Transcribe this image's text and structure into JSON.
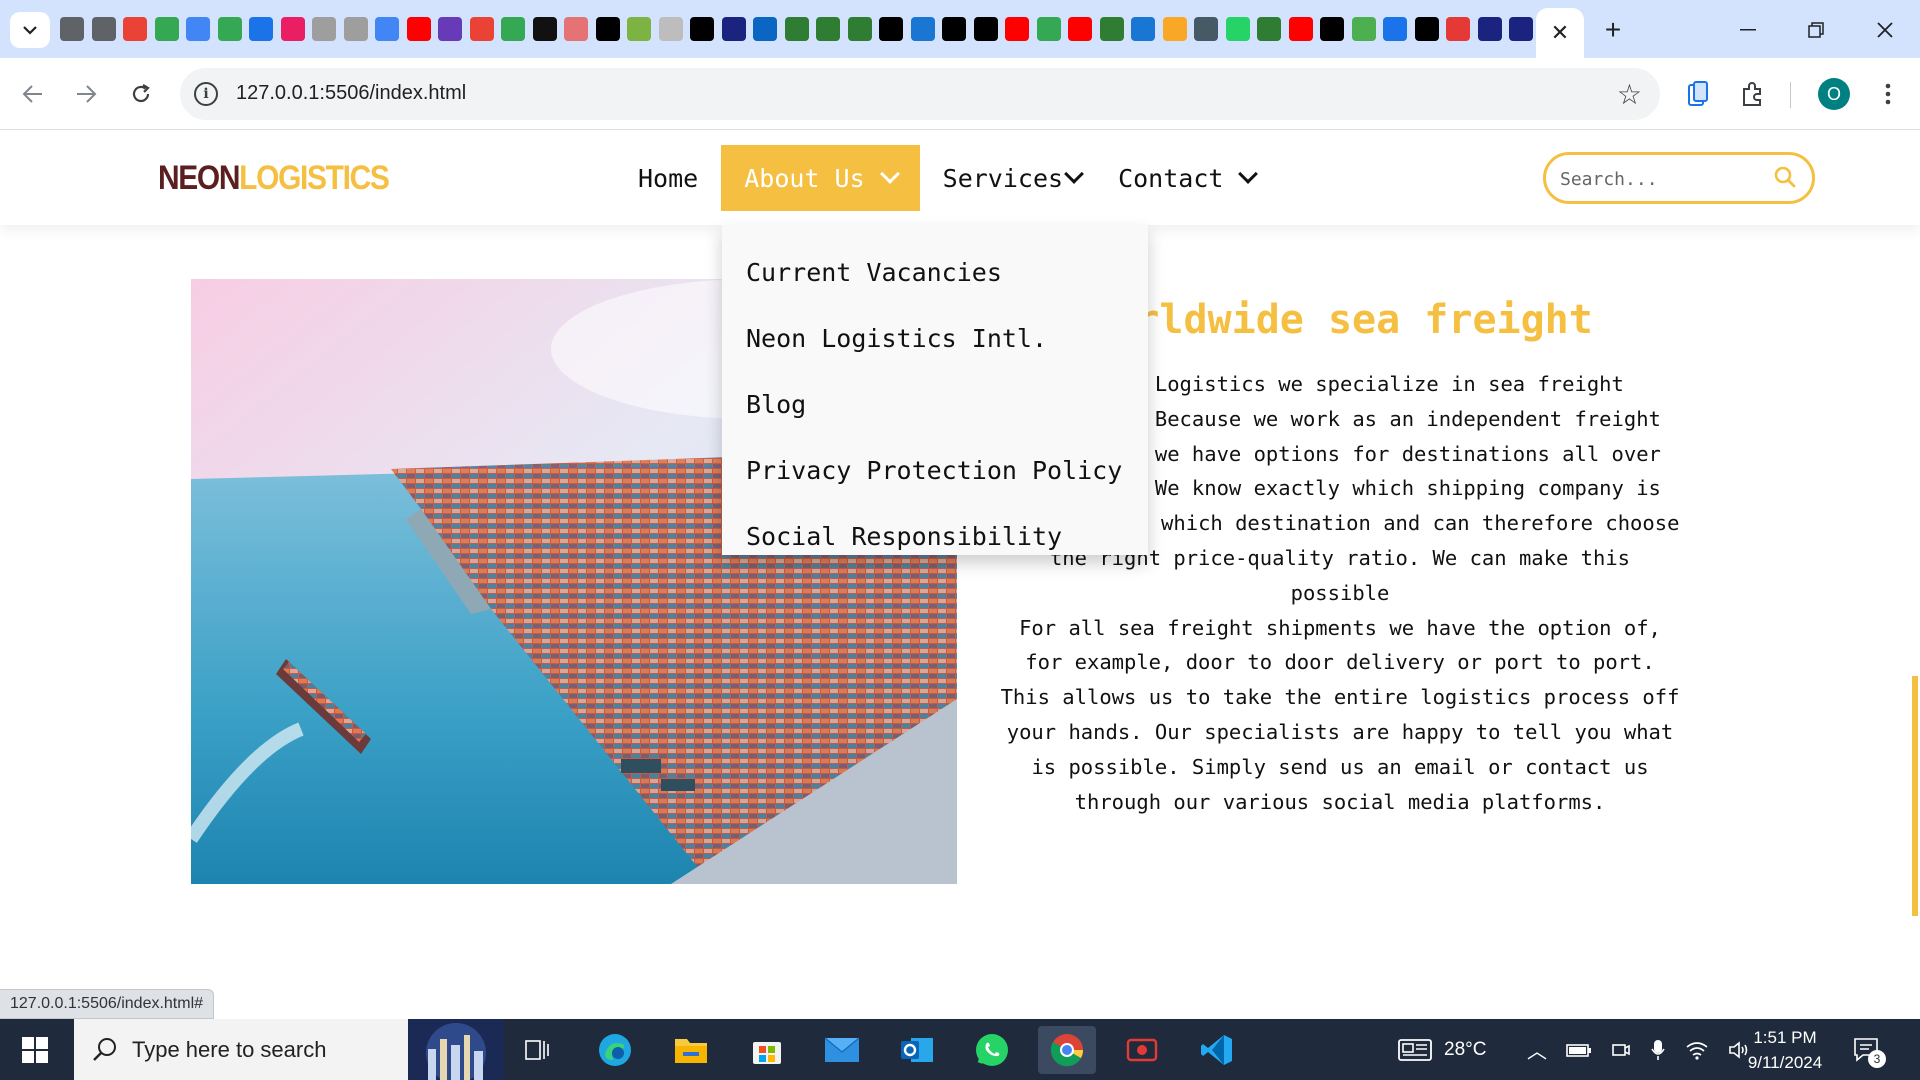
{
  "browser": {
    "active_tab_close": "✕",
    "new_tab": "+",
    "url": "127.0.0.1:5506/index.html",
    "favicon_colors": [
      "#5f6368",
      "#5f6368",
      "#ea4335",
      "#34a853",
      "#4285f4",
      "#34a853",
      "#1a73e8",
      "#e91e63",
      "#9e9e9e",
      "#9e9e9e",
      "#4285f4",
      "#ff0000",
      "#673ab7",
      "#ea4335",
      "#34a853",
      "#111111",
      "#e57373",
      "#000000",
      "#7cb342",
      "#bdbdbd",
      "#000000",
      "#1a237e",
      "#0a66c2",
      "#2e7d32",
      "#2e7d32",
      "#2e7d32",
      "#000000",
      "#1976d2",
      "#000000",
      "#000000",
      "#ff0000",
      "#34a853",
      "#ff0000",
      "#2e7d32",
      "#1976d2",
      "#f9a825",
      "#455a64",
      "#25d366",
      "#2e7d32",
      "#ff0000",
      "#000000",
      "#4caf50",
      "#1a73e8",
      "#000000",
      "#e53935",
      "#1a237e",
      "#1a237e"
    ]
  },
  "site": {
    "logo": {
      "part1": "NEON",
      "part2": "LOGISTICS"
    },
    "nav": {
      "home": "Home",
      "about": "About Us",
      "services": "Services",
      "contact": "Contact"
    },
    "search": {
      "placeholder": "Search..."
    },
    "dropdown": [
      "Current Vacancies",
      "Neon Logistics Intl.",
      "Blog",
      "Privacy Protection Policy",
      "Social Responsibility"
    ],
    "section": {
      "title": "Worldwide sea freight",
      "p1": "At Neon Logistics we specialize in sea freight transport. Because we work as an independent freight forwarder, we have options for destinations all over the world. We know exactly which shipping company is the best for which destination and can therefore choose the right price-quality ratio. We can make this possible",
      "p2": "For all sea freight shipments we have the option of, for example, door to door delivery or port to port. This allows us to take the entire logistics process off your hands. Our specialists are happy to tell you what is possible. Simply send us an email or contact us through our various social media platforms."
    },
    "status_url": "127.0.0.1:5506/index.html#",
    "accent_color": "#f5bf42"
  },
  "taskbar": {
    "search_placeholder": "Type here to search",
    "weather": "28°C",
    "time": "1:51 PM",
    "date": "9/11/2024",
    "notifications": "3"
  }
}
